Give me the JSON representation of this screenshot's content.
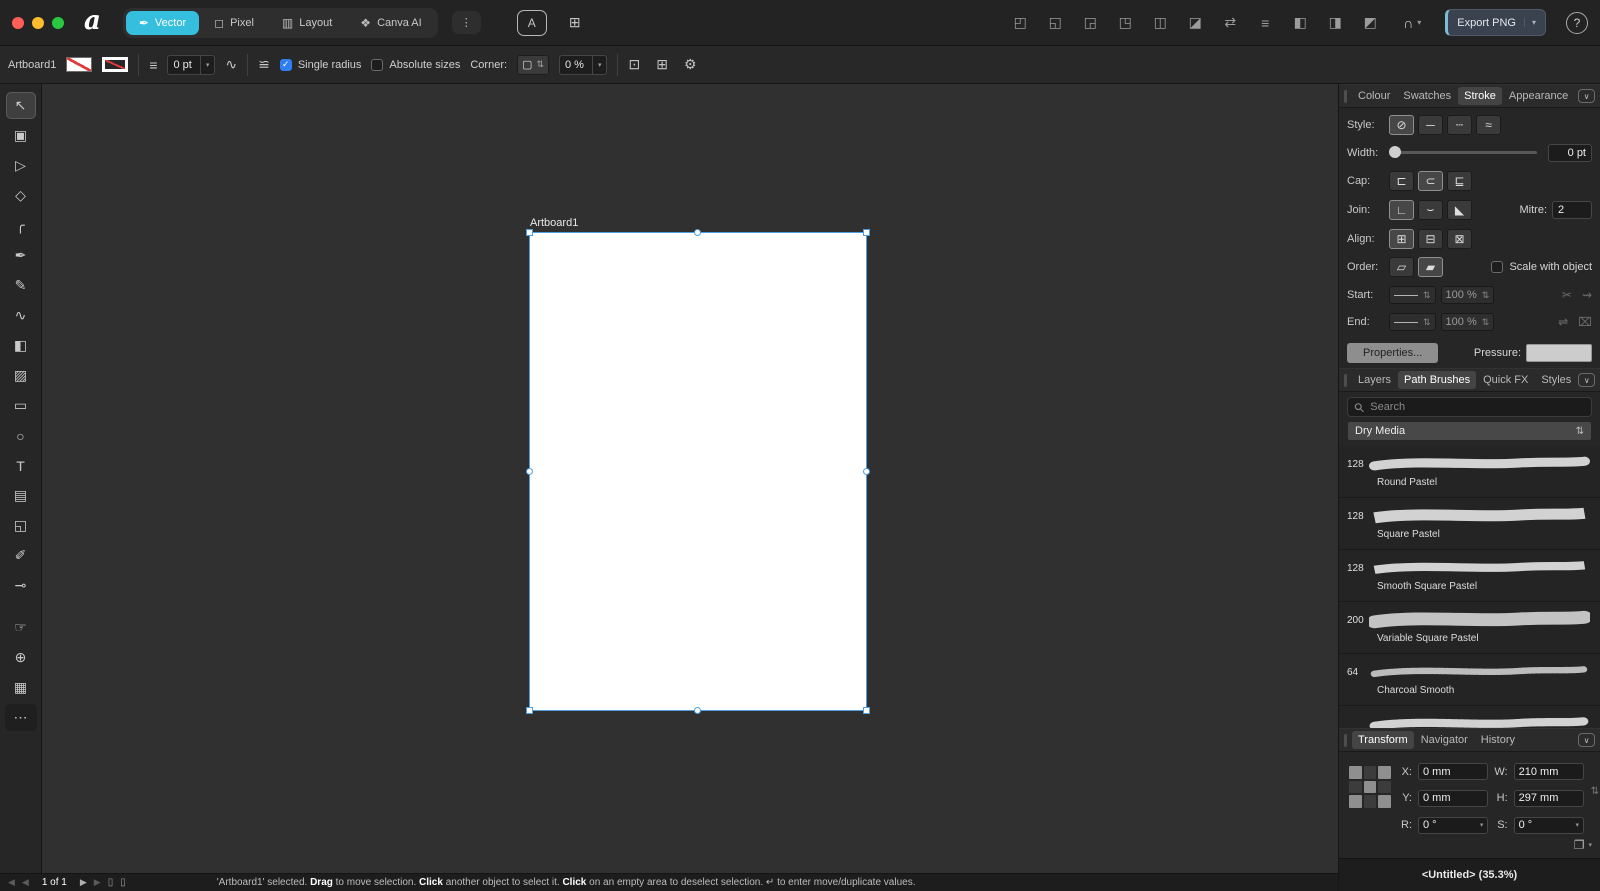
{
  "colors": {
    "accent_teal": "#35bede",
    "selection_blue": "#4f9fe0",
    "checkbox_blue": "#2f7ff0",
    "traffic_red": "#ff5f57",
    "traffic_yellow": "#febc2e",
    "traffic_green": "#28c840"
  },
  "top_bar": {
    "logo": "a",
    "personas": [
      {
        "label": "Vector",
        "glyph": "✒",
        "selected": true
      },
      {
        "label": "Pixel",
        "glyph": "◻"
      },
      {
        "label": "Layout",
        "glyph": "▥"
      },
      {
        "label": "Canva AI",
        "glyph": "❖"
      }
    ],
    "persona_menu_glyph": "⋮",
    "mid_icons": [
      {
        "name": "character-panel-icon",
        "glyph": "A"
      },
      {
        "name": "apps-grid-icon",
        "glyph": "⊞"
      }
    ],
    "right_icons": [
      {
        "name": "boolean-add-icon",
        "glyph": "◰"
      },
      {
        "name": "boolean-subtract-icon",
        "glyph": "◱"
      },
      {
        "name": "boolean-intersect-icon",
        "glyph": "◲"
      },
      {
        "name": "boolean-divide-icon",
        "glyph": "◳"
      },
      {
        "name": "boolean-combine-icon",
        "glyph": "◫"
      },
      {
        "name": "insert-target-icon",
        "glyph": "◪"
      },
      {
        "name": "flip-horizontal-icon",
        "glyph": "⇄"
      },
      {
        "name": "alignment-icon",
        "glyph": "≡"
      },
      {
        "name": "move-to-front-icon",
        "glyph": "◧"
      },
      {
        "name": "duplicate-icon",
        "glyph": "◨"
      },
      {
        "name": "move-to-back-icon",
        "glyph": "◩"
      }
    ],
    "snapping_glyph": "∩",
    "export_button": "Export PNG",
    "help_label": "?"
  },
  "context_bar": {
    "artboard_label": "Artboard1",
    "stroke_presets_glyph": "≡",
    "stroke_width_value": "0 pt",
    "pressure_profile_glyph": "∿",
    "sliders_glyph": "≌",
    "single_radius_label": "Single radius",
    "absolute_sizes_label": "Absolute sizes",
    "corner_label": "Corner:",
    "corner_type_glyph": "▢",
    "corner_value": "0 %",
    "icons": [
      {
        "name": "selection-box-icon",
        "glyph": "⊡"
      },
      {
        "name": "transform-objects-icon",
        "glyph": "⊞"
      },
      {
        "name": "assistant-gear-icon",
        "glyph": "⚙"
      }
    ]
  },
  "tools": [
    {
      "name": "move-tool",
      "glyph": "↖",
      "selected": true
    },
    {
      "name": "artboard-tool",
      "glyph": "▣"
    },
    {
      "name": "node-tool",
      "glyph": "▷"
    },
    {
      "name": "contour-tool",
      "glyph": "◇"
    },
    {
      "name": "corner-tool",
      "glyph": "╭"
    },
    {
      "name": "pen-tool",
      "glyph": "✒"
    },
    {
      "name": "pencil-tool",
      "glyph": "✎"
    },
    {
      "name": "vector-brush-tool",
      "glyph": "∿"
    },
    {
      "name": "fill-tool",
      "glyph": "◧"
    },
    {
      "name": "transparency-tool",
      "glyph": "▨"
    },
    {
      "name": "rectangle-tool",
      "glyph": "▭"
    },
    {
      "name": "ellipse-tool",
      "glyph": "○"
    },
    {
      "name": "text-tool",
      "glyph": "T"
    },
    {
      "name": "image-place-tool",
      "glyph": "▤"
    },
    {
      "name": "vector-crop-tool",
      "glyph": "◱"
    },
    {
      "name": "style-picker-tool",
      "glyph": "✐"
    },
    {
      "name": "colour-picker-tool",
      "glyph": "⊸"
    },
    {
      "name": "hand-tool",
      "glyph": "☞"
    },
    {
      "name": "zoom-tool",
      "glyph": "⊕"
    },
    {
      "name": "grid-tool",
      "glyph": "▦"
    },
    {
      "name": "more-tools-button",
      "glyph": "⋯"
    }
  ],
  "canvas": {
    "artboard_title": "Artboard1"
  },
  "stroke_panel": {
    "tabs": [
      {
        "label": "Colour"
      },
      {
        "label": "Swatches"
      },
      {
        "label": "Stroke",
        "active": true
      },
      {
        "label": "Appearance"
      }
    ],
    "style_label": "Style:",
    "style_options": [
      {
        "name": "no-stroke-icon",
        "glyph": "⊘",
        "selected": true
      },
      {
        "name": "solid-stroke-icon",
        "glyph": "─"
      },
      {
        "name": "dash-stroke-icon",
        "glyph": "┄"
      },
      {
        "name": "texture-stroke-icon",
        "glyph": "≈"
      }
    ],
    "width_label": "Width:",
    "width_value": "0 pt",
    "cap_label": "Cap:",
    "cap_options": [
      {
        "name": "cap-butt-icon",
        "glyph": "⊏"
      },
      {
        "name": "cap-round-icon",
        "glyph": "⊂",
        "selected": true
      },
      {
        "name": "cap-square-icon",
        "glyph": "⊑"
      }
    ],
    "join_label": "Join:",
    "join_options": [
      {
        "name": "join-mitre-icon",
        "glyph": "∟",
        "selected": true
      },
      {
        "name": "join-round-icon",
        "glyph": "⌣"
      },
      {
        "name": "join-bevel-icon",
        "glyph": "◣"
      }
    ],
    "mitre_label": "Mitre:",
    "mitre_value": "2",
    "align_label": "Align:",
    "align_options": [
      {
        "name": "align-centre-icon",
        "glyph": "⊞",
        "selected": true
      },
      {
        "name": "align-inside-icon",
        "glyph": "⊟"
      },
      {
        "name": "align-outside-icon",
        "glyph": "⊠"
      }
    ],
    "order_label": "Order:",
    "order_options": [
      {
        "name": "stroke-behind-icon",
        "glyph": "▱"
      },
      {
        "name": "stroke-front-icon",
        "glyph": "▰",
        "selected": true
      }
    ],
    "scale_with_object_label": "Scale with object",
    "start_label": "Start:",
    "start_pct": "100 %",
    "end_label": "End:",
    "end_pct": "100 %",
    "start_icons": [
      {
        "name": "scissors-icon",
        "glyph": "✂",
        "dim": true
      },
      {
        "name": "copy-pressure-icon",
        "glyph": "⇝",
        "dim": true
      }
    ],
    "end_icons": [
      {
        "name": "swap-ends-icon",
        "glyph": "⇌",
        "dim": true
      },
      {
        "name": "delete-pressure-icon",
        "glyph": "⌧",
        "dim": true
      }
    ],
    "properties_button": "Properties...",
    "pressure_label": "Pressure:"
  },
  "brushes_panel": {
    "tabs": [
      {
        "label": "Layers"
      },
      {
        "label": "Path Brushes",
        "active": true
      },
      {
        "label": "Quick FX"
      },
      {
        "label": "Styles"
      }
    ],
    "search_placeholder": "Search",
    "category": "Dry Media",
    "brushes": [
      {
        "size": "128",
        "name": "Round Pastel"
      },
      {
        "size": "128",
        "name": "Square Pastel"
      },
      {
        "size": "128",
        "name": "Smooth Square Pastel"
      },
      {
        "size": "200",
        "name": "Variable Square Pastel"
      },
      {
        "size": "64",
        "name": "Charcoal Smooth"
      },
      {
        "size": "",
        "name": ""
      }
    ]
  },
  "transform_panel": {
    "tabs": [
      {
        "label": "Transform",
        "active": true
      },
      {
        "label": "Navigator"
      },
      {
        "label": "History"
      }
    ],
    "rows": [
      {
        "l1": "X:",
        "v1": "0 mm",
        "l2": "W:",
        "v2": "210 mm"
      },
      {
        "l1": "Y:",
        "v1": "0 mm",
        "l2": "H:",
        "v2": "297 mm"
      },
      {
        "l1": "R:",
        "v1": "0 °",
        "l2": "S:",
        "v2": "0 °",
        "caret": true
      }
    ]
  },
  "status_bar": {
    "first_glyph": "◀",
    "prev_glyph": "◀",
    "page_indicator": "1 of 1",
    "next_glyph": "▶",
    "last_glyph": "▶",
    "page_icons": [
      {
        "name": "page-thumbnail-icon",
        "glyph": "▯"
      },
      {
        "name": "pages-view-icon",
        "glyph": "▯"
      }
    ],
    "message": [
      {
        "text": "'Artboard1' selected. ",
        "bold": false
      },
      {
        "text": "Drag",
        "bold": true
      },
      {
        "text": " to move selection. ",
        "bold": false
      },
      {
        "text": "Click",
        "bold": true
      },
      {
        "text": " another object to select it. ",
        "bold": false
      },
      {
        "text": "Click",
        "bold": true
      },
      {
        "text": " on an empty area to deselect selection. ↵ to enter move/duplicate values.",
        "bold": false
      }
    ],
    "doc_info": "<Untitled> (35.3%)"
  }
}
